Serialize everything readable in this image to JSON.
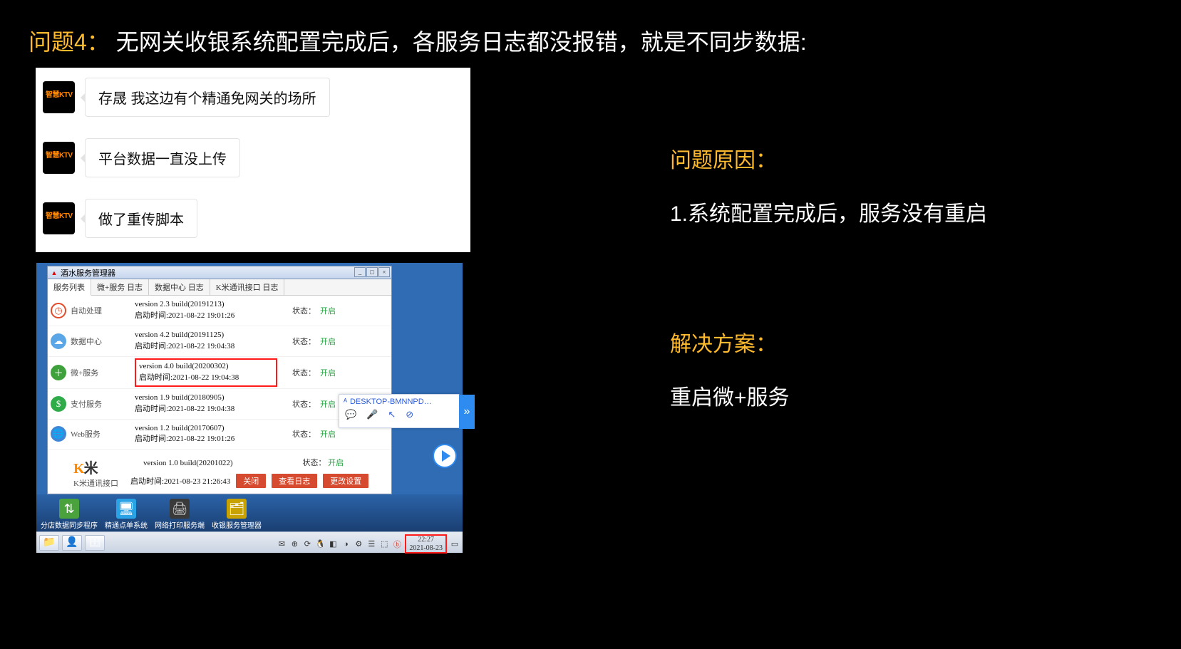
{
  "title": {
    "label": "问题4：",
    "text": "无网关收银系统配置完成后，各服务日志都没报错，就是不同步数据:"
  },
  "chat": {
    "avatar_text": "智慧KTV",
    "msgs": [
      "存晟   我这边有个精通免网关的场所",
      "平台数据一直没上传",
      "做了重传脚本"
    ]
  },
  "window": {
    "title": "酒水服务管理器",
    "tabs": [
      "服务列表",
      "微+服务 日志",
      "数据中心 日志",
      "K米通讯接口 日志"
    ],
    "status_label": "状态：",
    "status_value": "开启",
    "services": [
      {
        "name": "自动处理",
        "v": "version 2.3 build(20191213)",
        "t": "启动时间:2021-08-22 19:01:26",
        "icon": "clock-icon",
        "hl": false
      },
      {
        "name": "数据中心",
        "v": "version 4.2 build(20191125)",
        "t": "启动时间:2021-08-22 19:04:38",
        "icon": "cloud-icon",
        "hl": false
      },
      {
        "name": "微+服务",
        "v": "version 4.0 build(20200302)",
        "t": "启动时间:2021-08-22 19:04:38",
        "icon": "plus-icon",
        "hl": true
      },
      {
        "name": "支付服务",
        "v": "version 1.9 build(20180905)",
        "t": "启动时间:2021-08-22 19:04:38",
        "icon": "dollar-icon",
        "hl": false
      },
      {
        "name": "Web服务",
        "v": "version 1.2 build(20170607)",
        "t": "启动时间:2021-08-22 19:01:26",
        "icon": "globe-icon",
        "hl": false
      }
    ],
    "km": {
      "name": "K米通讯接口",
      "v": "version 1.0 build(20201022)",
      "t": "启动时间:2021-08-23 21:26:43",
      "btn_close": "关闭",
      "btn_log": "查看日志",
      "btn_set": "更改设置"
    }
  },
  "popup": {
    "host": "DESKTOP-BMNNPD…"
  },
  "taskbar1_items": [
    {
      "label": "分店数据同步程序",
      "icon": "sync-stack-icon"
    },
    {
      "label": "精通点单系统",
      "icon": "pos-icon"
    },
    {
      "label": "网络打印服务端",
      "icon": "printer-icon"
    },
    {
      "label": "收银服务管理器",
      "icon": "folder-icon"
    }
  ],
  "tray": {
    "time": "22:27",
    "date": "2021-08-23"
  },
  "right": {
    "cause_title": "问题原因：",
    "cause_body": "1.系统配置完成后，服务没有重启",
    "solution_title": "解决方案：",
    "solution_body": "重启微+服务"
  }
}
